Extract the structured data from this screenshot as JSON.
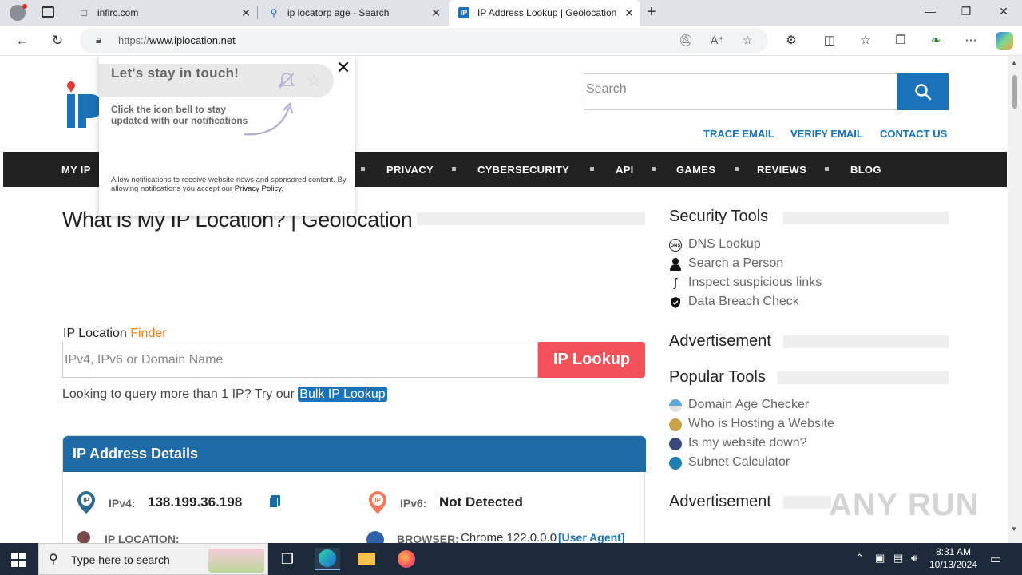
{
  "browser": {
    "tabs": [
      {
        "title": "infirc.com",
        "active": false
      },
      {
        "title": "ip locatorp age - Search",
        "active": false
      },
      {
        "title": "IP Address Lookup | Geolocation",
        "active": true
      }
    ],
    "url_prefix": "https://",
    "url_host": "www.iplocation.net"
  },
  "site": {
    "search_placeholder": "Search",
    "top_links": [
      "TRACE EMAIL",
      "VERIFY EMAIL",
      "CONTACT US"
    ],
    "nav": [
      "MY IP",
      "PRIVACY",
      "CYBERSECURITY",
      "API",
      "GAMES",
      "REVIEWS",
      "BLOG"
    ],
    "accent": "#1a72b8"
  },
  "main": {
    "title": "What is My IP Location? | Geolocation",
    "finder_label": "IP Location ",
    "finder_label_accent": "Finder",
    "input_placeholder": "IPv4, IPv6 or Domain Name",
    "lookup_button": "IP Lookup",
    "bulk_text": "Looking to query more than 1 IP? Try our ",
    "bulk_link": "Bulk IP Lookup",
    "details_title": "IP Address Details",
    "ipv4_label": "IPv4:",
    "ipv4_value": "138.199.36.198",
    "ipv6_label": "IPv6:",
    "ipv6_value": "Not Detected",
    "ip_location_label": "IP LOCATION:",
    "browser_label": "BROWSER:",
    "browser_value": "Chrome 122.0.0.0",
    "user_agent_link": "[User Agent]"
  },
  "sidebar": {
    "security_title": "Security Tools",
    "security_items": [
      "DNS Lookup",
      "Search a Person",
      "Inspect suspicious links",
      "Data Breach Check"
    ],
    "ad_title": "Advertisement",
    "popular_title": "Popular Tools",
    "popular_items": [
      "Domain Age Checker",
      "Who is Hosting a Website",
      "Is my website down?",
      "Subnet Calculator"
    ],
    "ad_title_2": "Advertisement"
  },
  "popup": {
    "title": "Let's stay in touch!",
    "text": "Click the icon bell to stay updated with our notifications",
    "small_text": "Allow notifications to receive website news and sponsored content. By allowing notifications you accept our ",
    "policy_link": "Privacy Policy",
    "period": "."
  },
  "taskbar": {
    "search_placeholder": "Type here to search",
    "time": "8:31 AM",
    "date": "10/13/2024"
  },
  "watermark": "ANY RUN"
}
